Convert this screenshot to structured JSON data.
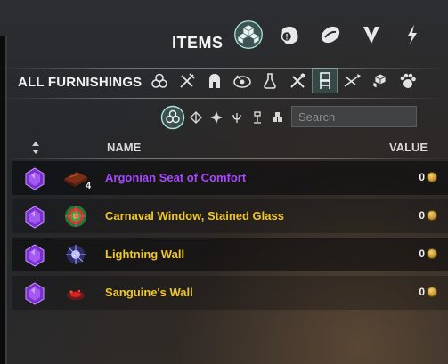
{
  "header": {
    "title": "ITEMS",
    "categories": [
      {
        "icon": "furnishing-cubes-icon",
        "active": true
      },
      {
        "icon": "materials-icon",
        "active": false
      },
      {
        "icon": "consumable-icon",
        "active": false
      },
      {
        "icon": "gear-icon",
        "active": false
      },
      {
        "icon": "spell-icon",
        "active": false
      }
    ]
  },
  "subheader": {
    "title": "ALL FURNISHINGS",
    "filters": [
      "all-furnishings-icon",
      "crafting-station-icon",
      "helmet-icon",
      "blueprint-icon",
      "flask-icon",
      "tools-icon",
      "chair-icon",
      "arrows-icon",
      "crates-icon",
      "paw-icon"
    ],
    "active_filter": "chair-icon"
  },
  "filter_row": {
    "icons": [
      "all-icon",
      "diamond-icon",
      "cross-icon",
      "candle-icon",
      "lamp-icon",
      "blocks-icon"
    ],
    "search_placeholder": "Search"
  },
  "table": {
    "col_name": "NAME",
    "col_value": "VALUE",
    "rows": [
      {
        "name": "Argonian Seat of Comfort",
        "qty": "4",
        "value": "0",
        "color": "#a747ff",
        "thumb": "seat-thumbnail"
      },
      {
        "name": "Carnaval Window, Stained Glass",
        "qty": "",
        "value": "0",
        "color": "#f0c72a",
        "thumb": "window-thumbnail"
      },
      {
        "name": "Lightning Wall",
        "qty": "",
        "value": "0",
        "color": "#f0c72a",
        "thumb": "lightning-thumbnail"
      },
      {
        "name": "Sanguine's Wall",
        "qty": "",
        "value": "0",
        "color": "#f0c72a",
        "thumb": "blood-wall-thumbnail"
      }
    ]
  },
  "colors": {
    "purple_item": "#a747ff",
    "gold_item": "#f0c72a",
    "accent_teal": "#8fdad0"
  }
}
